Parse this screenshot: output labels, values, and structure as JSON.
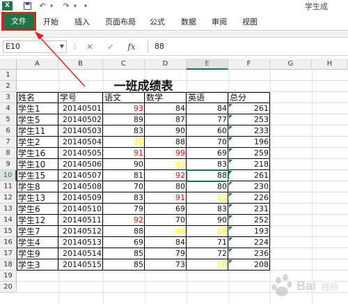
{
  "window": {
    "app_icon_letter": "X",
    "title": "学生成"
  },
  "quick_access": [
    "💾",
    "↶",
    "↷",
    "▾"
  ],
  "ribbon": {
    "file_tab": "文件",
    "tabs": [
      "开始",
      "插入",
      "页面布局",
      "公式",
      "数据",
      "审阅",
      "视图"
    ]
  },
  "formula_bar": {
    "name_box": "E10",
    "cancel_glyph": "✕",
    "enter_glyph": "✓",
    "fx_label": "fx",
    "value": "88"
  },
  "columns": [
    "A",
    "B",
    "C",
    "D",
    "E",
    "F",
    "G",
    "H"
  ],
  "selected_column": "E",
  "rows": [
    "1",
    "2",
    "3",
    "4",
    "5",
    "6",
    "7",
    "8",
    "9",
    "10",
    "11",
    "12",
    "13",
    "14",
    "15",
    "16",
    "17",
    "18",
    "19",
    "20"
  ],
  "selected_row": "10",
  "sheet": {
    "title": "一班成绩表",
    "headers": [
      "姓名",
      "学号",
      "语文",
      "数学",
      "英语",
      "总分"
    ],
    "records": [
      {
        "name": "学生1",
        "id": "20140501",
        "chinese": "93",
        "math": "84",
        "english": "84",
        "total": "261"
      },
      {
        "name": "学生5",
        "id": "20140502",
        "chinese": "89",
        "math": "87",
        "english": "77",
        "total": "253"
      },
      {
        "name": "学生11",
        "id": "20140503",
        "chinese": "83",
        "math": "90",
        "english": "60",
        "total": "233"
      },
      {
        "name": "学生2",
        "id": "20140504",
        "chinese": "38",
        "math": "88",
        "english": "70",
        "total": "196"
      },
      {
        "name": "学生16",
        "id": "20140505",
        "chinese": "91",
        "math": "99",
        "english": "69",
        "total": "259"
      },
      {
        "name": "学生10",
        "id": "20140506",
        "chinese": "90",
        "math": "45",
        "english": "83",
        "total": "218"
      },
      {
        "name": "学生15",
        "id": "20140507",
        "chinese": "81",
        "math": "92",
        "english": "88",
        "total": "261"
      },
      {
        "name": "学生8",
        "id": "20140508",
        "chinese": "70",
        "math": "80",
        "english": "80",
        "total": "230"
      },
      {
        "name": "学生13",
        "id": "20140509",
        "chinese": "83",
        "math": "91",
        "english": "52",
        "total": "226"
      },
      {
        "name": "学生6",
        "id": "20140510",
        "chinese": "79",
        "math": "69",
        "english": "83",
        "total": "231"
      },
      {
        "name": "学生12",
        "id": "20140511",
        "chinese": "92",
        "math": "70",
        "english": "90",
        "total": "252"
      },
      {
        "name": "学生7",
        "id": "20140512",
        "chinese": "88",
        "math": "46",
        "english": "59",
        "total": "193"
      },
      {
        "name": "学生4",
        "id": "20140513",
        "chinese": "69",
        "math": "84",
        "english": "71",
        "total": "224"
      },
      {
        "name": "学生9",
        "id": "20140514",
        "chinese": "85",
        "math": "79",
        "english": "72",
        "total": "236"
      },
      {
        "name": "学生3",
        "id": "20140515",
        "chinese": "85",
        "math": "73",
        "english": "50",
        "total": "208"
      }
    ],
    "highlight_colors": {
      "high": "#ff0000",
      "low": "#ffff00",
      "normal": "#111111"
    },
    "high_cells": [
      [
        "chinese",
        0
      ],
      [
        "chinese",
        4
      ],
      [
        "chinese",
        10
      ],
      [
        "math",
        4
      ],
      [
        "math",
        6
      ],
      [
        "math",
        8
      ]
    ],
    "low_cells": [
      [
        "chinese",
        3
      ],
      [
        "math",
        5
      ],
      [
        "math",
        11
      ],
      [
        "english",
        8
      ],
      [
        "english",
        11
      ],
      [
        "english",
        14
      ]
    ]
  },
  "watermark_text": "Bai 经验",
  "colors": {
    "excel_green": "#217346",
    "annotation_red": "#ee1c1c"
  }
}
